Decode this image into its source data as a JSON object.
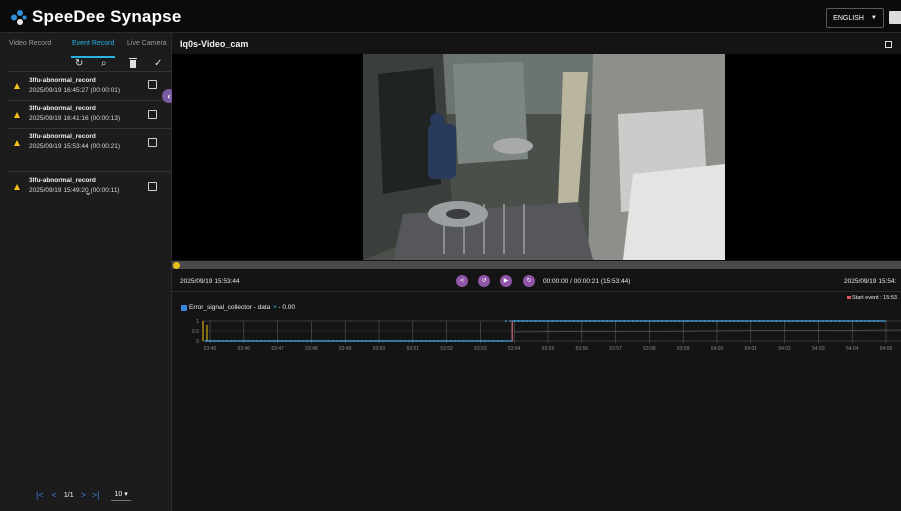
{
  "header": {
    "app_name": "SpeeDee Synapse",
    "language": "ENGLISH"
  },
  "sidebar": {
    "tabs": [
      "Video Record",
      "Event Record",
      "Live Camera"
    ],
    "active_tab": "Event Record",
    "toolbar_icons": [
      "refresh-icon",
      "search-icon",
      "trash-icon",
      "check-icon"
    ],
    "records": [
      {
        "name": "3lfu-abnormal_record",
        "time": "2025/09/19 16:45:27 (00:00:01)"
      },
      {
        "name": "3lfu-abnormal_record",
        "time": "2025/09/19 16:41:16 (00:00:13)"
      },
      {
        "name": "3lfu-abnormal_record",
        "time": "2025/09/19 15:53:44 (00:00:21)"
      },
      {
        "name": "3lfu-abnormal_record",
        "time": "2025/09/19 15:49:20 (00:00:11)"
      }
    ],
    "pager": {
      "page": "1/1",
      "page_size": "10"
    }
  },
  "player": {
    "title": "Iq0s-Video_cam",
    "start_time": "2025/09/19 15:53:44",
    "end_time": "2025/09/19 15:54:",
    "playback": "00:00:00 / 00:00:21 (15:53:44)",
    "progress": 0
  },
  "graph": {
    "legend": "Error_signal_collector - data",
    "legend_value": "- 0.00",
    "start_event": "Start event : 15:53",
    "colors": {
      "series": "#4aa3df",
      "marker": "#e05555",
      "bars": "#f5c518"
    }
  },
  "chart_data": {
    "type": "line",
    "title": "",
    "xlabel": "",
    "ylabel": "",
    "x": [
      "53:45",
      "53:46",
      "53:47",
      "53:48",
      "53:49",
      "53:50",
      "53:51",
      "53:52",
      "53:53",
      "53:54",
      "53:55",
      "53:56",
      "53:57",
      "53:58",
      "53:59",
      "54:00",
      "54:01",
      "54:02",
      "54:03",
      "54:04",
      "54:05"
    ],
    "yticks": [
      "1",
      "0.5",
      "0"
    ],
    "ylim": [
      0,
      1
    ],
    "series": [
      {
        "name": "Error_signal_collector - data",
        "values": [
          0,
          0,
          0,
          0,
          0,
          0,
          0,
          0,
          0,
          1,
          1,
          1,
          1,
          1,
          1,
          1,
          1,
          1,
          1,
          1,
          1
        ]
      }
    ],
    "grid": true
  }
}
